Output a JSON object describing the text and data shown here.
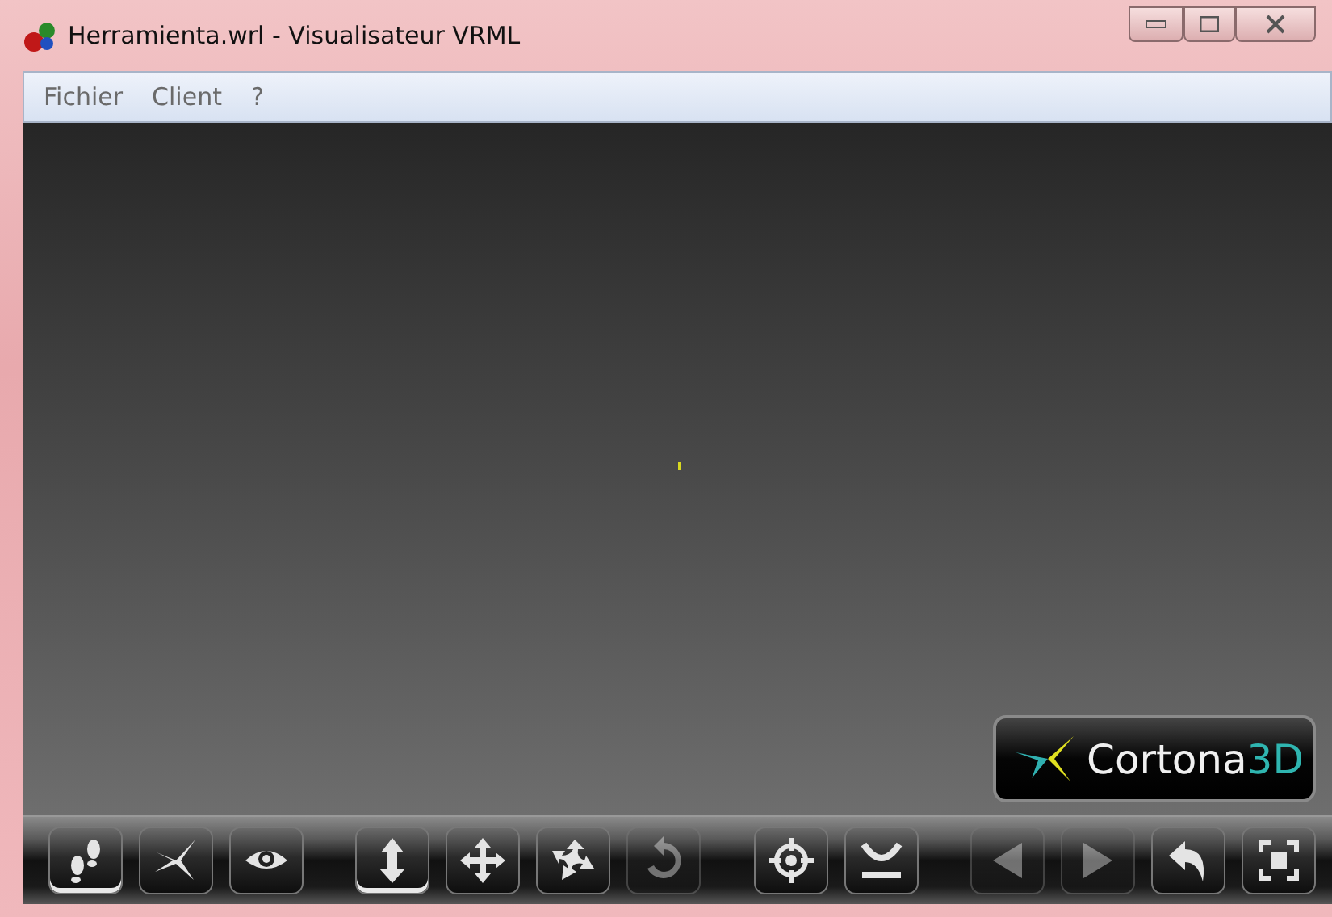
{
  "window": {
    "title": "Herramienta.wrl - Visualisateur VRML"
  },
  "menu": [
    "Fichier",
    "Client",
    "?"
  ],
  "logo": {
    "name": "Cortona",
    "suffix": "3D"
  },
  "toolbar": {
    "groups": [
      [
        {
          "kind": "walk",
          "selected": true,
          "disabled": false
        },
        {
          "kind": "fly",
          "selected": false,
          "disabled": false
        },
        {
          "kind": "study",
          "selected": false,
          "disabled": false
        }
      ],
      [
        {
          "kind": "plane",
          "selected": true,
          "disabled": false
        },
        {
          "kind": "pan",
          "selected": false,
          "disabled": false
        },
        {
          "kind": "turn",
          "selected": false,
          "disabled": false
        },
        {
          "kind": "roll",
          "selected": false,
          "disabled": true
        }
      ],
      [
        {
          "kind": "goto",
          "selected": false,
          "disabled": false
        },
        {
          "kind": "align",
          "selected": false,
          "disabled": false
        }
      ],
      [
        {
          "kind": "prev",
          "selected": false,
          "disabled": true
        },
        {
          "kind": "next",
          "selected": false,
          "disabled": true
        },
        {
          "kind": "restore",
          "selected": false,
          "disabled": false
        },
        {
          "kind": "fit",
          "selected": false,
          "disabled": false
        }
      ]
    ]
  }
}
